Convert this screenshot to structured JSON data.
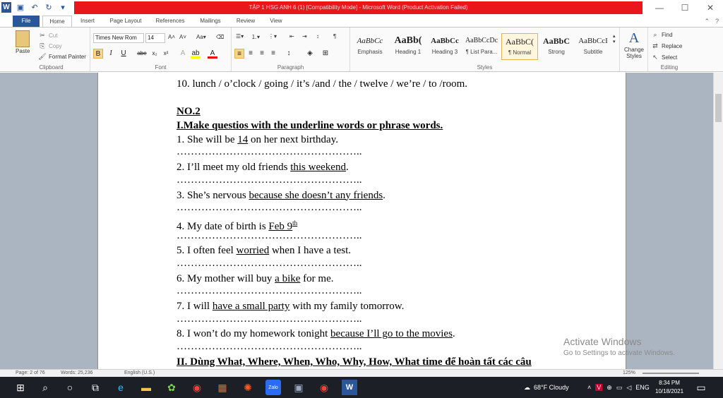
{
  "window": {
    "title": "TẬP 1 HSG ANH 6 (1) [Compatibility Mode] - Microsoft Word (Product Activation Failed)",
    "minimize": "—",
    "maximize": "☐",
    "close": "✕"
  },
  "tabs": [
    "File",
    "Home",
    "Insert",
    "Page Layout",
    "References",
    "Mailings",
    "Review",
    "View"
  ],
  "active_tab": "Home",
  "ribbon": {
    "clipboard": {
      "label": "Clipboard",
      "paste": "Paste",
      "cut": "Cut",
      "copy": "Copy",
      "format_painter": "Format Painter"
    },
    "font": {
      "label": "Font",
      "family": "Times New Rom",
      "size": "14",
      "bold": "B",
      "italic": "I",
      "underline": "U",
      "strike": "abe",
      "subscript": "x₂",
      "superscript": "x²"
    },
    "paragraph": {
      "label": "Paragraph"
    },
    "styles": {
      "label": "Styles",
      "items": [
        {
          "preview": "AaBbCc",
          "name": "Emphasis"
        },
        {
          "preview": "AaBb(",
          "name": "Heading 1"
        },
        {
          "preview": "AaBbCc",
          "name": "Heading 3"
        },
        {
          "preview": "AaBbCcDc",
          "name": "¶ List Para..."
        },
        {
          "preview": "AaBbC(",
          "name": "¶ Normal"
        },
        {
          "preview": "AaBbC",
          "name": "Strong"
        },
        {
          "preview": "AaBbCcI",
          "name": "Subtitle"
        }
      ],
      "change_styles": "Change Styles"
    },
    "editing": {
      "label": "Editing",
      "find": "Find",
      "replace": "Replace",
      "select": "Select"
    }
  },
  "document": {
    "line10": "10. lunch / o’clock / going / it’s /and / the / twelve / we’re / to /room.",
    "no2": "NO.2",
    "heading1": "I.Make questios with the underline words or phrase words.",
    "dots": "……………………………………………..",
    "items": [
      {
        "pre": "1. She will be ",
        "u": "14",
        "post": " on her next birthday."
      },
      {
        "pre": "2. I’ll meet my old friends ",
        "u": "this weekend",
        "post": "."
      },
      {
        "pre": "3. She’s nervous ",
        "u": "because she doesn’t any friends",
        "post": "."
      },
      {
        "pre": "4. My date of birth is ",
        "u": "Feb 9",
        "sup": "th",
        "post": ""
      },
      {
        "pre": "5. I often feel ",
        "u": "worried",
        "post": " when I have a test."
      },
      {
        "pre": "6. My mother will buy ",
        "u": "a bike",
        "post": " for me."
      },
      {
        "pre": "7. I will ",
        "u": "have a small party",
        "post": " with my family tomorrow."
      },
      {
        "pre": "8. I won’t do my homework tonight ",
        "u": "because I’ll go to the movies",
        "post": "."
      }
    ],
    "heading2": "II. Dùng What, Where, When, Who, Why, How, What time để hoàn tất các câu"
  },
  "watermark": {
    "line1": "Activate Windows",
    "line2": "Go to Settings to activate Windows."
  },
  "statusbar": {
    "page": "Page: 2 of 76",
    "words": "Words: 25,236",
    "language": "English (U.S.)",
    "zoom": "125%"
  },
  "taskbar": {
    "weather": "68°F  Cloudy",
    "language": "ENG",
    "time": "8:34 PM",
    "date": "10/18/2021"
  }
}
